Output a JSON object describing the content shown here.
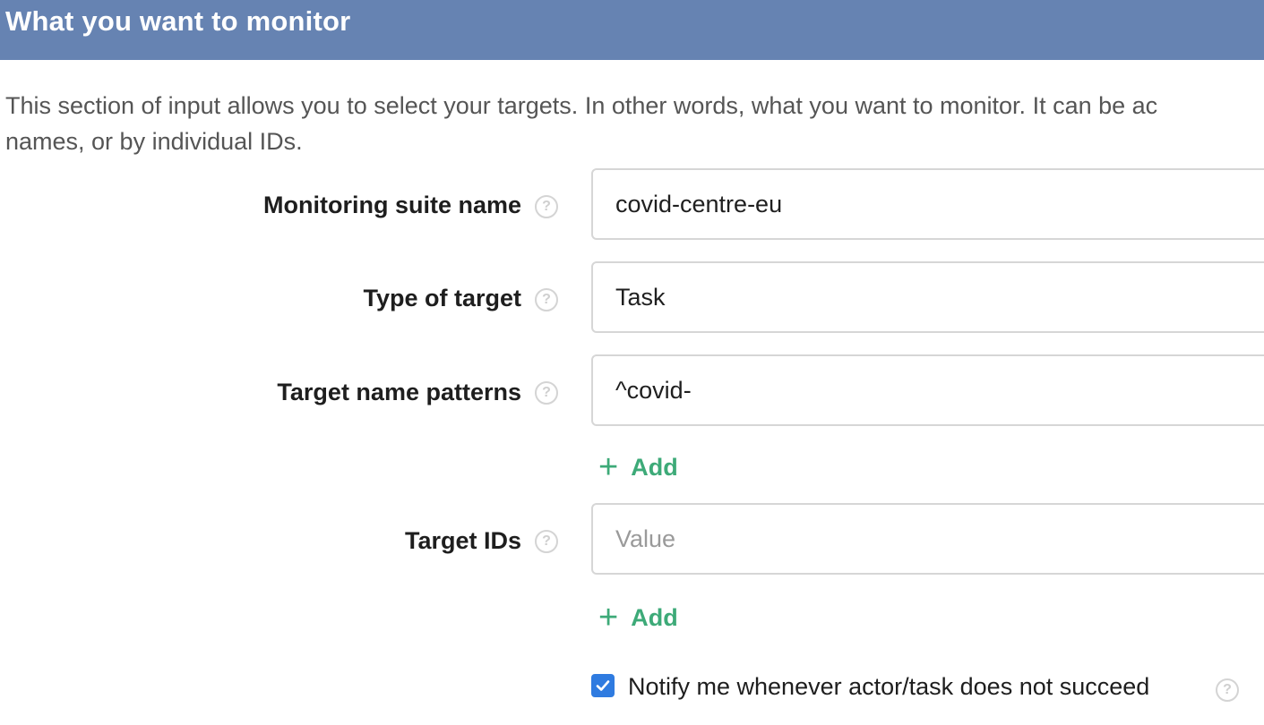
{
  "header": {
    "title": "What you want to monitor"
  },
  "description": {
    "line1": "This section of input allows you to select your targets. In other words, what you want to monitor. It can be ac",
    "line2": "names, or by individual IDs."
  },
  "fields": {
    "suite_name": {
      "label": "Monitoring suite name",
      "value": "covid-centre-eu"
    },
    "target_type": {
      "label": "Type of target",
      "value": "Task"
    },
    "name_patterns": {
      "label": "Target name patterns",
      "value": "^covid-",
      "add_label": "Add"
    },
    "target_ids": {
      "label": "Target IDs",
      "placeholder": "Value",
      "add_label": "Add"
    }
  },
  "notify": {
    "label": "Notify me whenever actor/task does not succeed",
    "checked": true
  },
  "help_glyph": "?",
  "colors": {
    "header_bg": "#6683b2",
    "accent_green": "#3daa78",
    "checkbox_blue": "#2f7be0"
  }
}
